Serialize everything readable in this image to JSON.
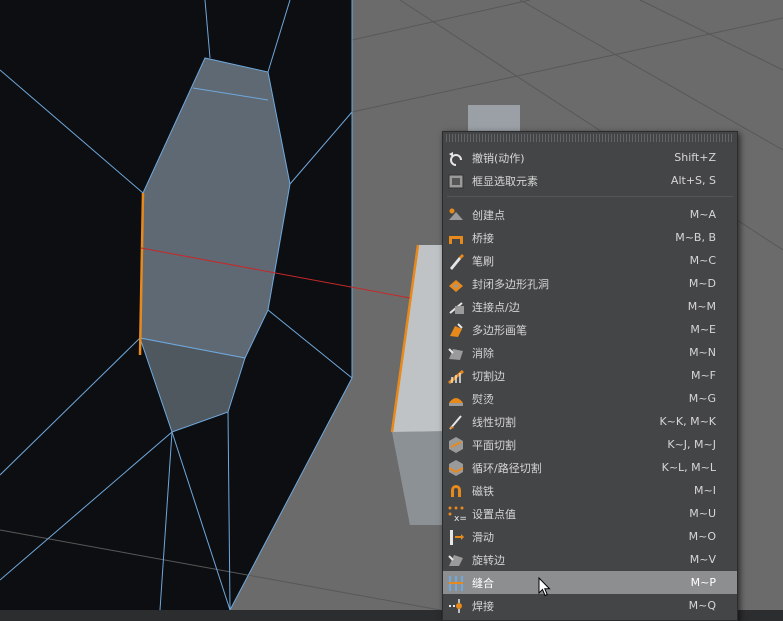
{
  "menu": {
    "group_top": [
      {
        "label": "撤销(动作)",
        "shortcut": "Shift+Z",
        "icon": "undo-icon"
      },
      {
        "label": "框显选取元素",
        "shortcut": "Alt+S, S",
        "icon": "frame-selected-icon"
      }
    ],
    "group_tools": [
      {
        "label": "创建点",
        "shortcut": "M~A",
        "icon": "create-point-icon"
      },
      {
        "label": "桥接",
        "shortcut": "M~B, B",
        "icon": "bridge-icon"
      },
      {
        "label": "笔刷",
        "shortcut": "M~C",
        "icon": "brush-icon"
      },
      {
        "label": "封闭多边形孔洞",
        "shortcut": "M~D",
        "icon": "close-polygon-hole-icon"
      },
      {
        "label": "连接点/边",
        "shortcut": "M~M",
        "icon": "connect-points-edges-icon"
      },
      {
        "label": "多边形画笔",
        "shortcut": "M~E",
        "icon": "polygon-pen-icon"
      },
      {
        "label": "消除",
        "shortcut": "M~N",
        "icon": "dissolve-icon"
      },
      {
        "label": "切割边",
        "shortcut": "M~F",
        "icon": "edge-cut-icon"
      },
      {
        "label": "熨烫",
        "shortcut": "M~G",
        "icon": "iron-icon"
      },
      {
        "label": "线性切割",
        "shortcut": "K~K, M~K",
        "icon": "line-cut-icon"
      },
      {
        "label": "平面切割",
        "shortcut": "K~J, M~J",
        "icon": "plane-cut-icon"
      },
      {
        "label": "循环/路径切割",
        "shortcut": "K~L, M~L",
        "icon": "loop-path-cut-icon"
      },
      {
        "label": "磁铁",
        "shortcut": "M~I",
        "icon": "magnet-icon"
      },
      {
        "label": "设置点值",
        "shortcut": "M~U",
        "icon": "set-point-value-icon"
      },
      {
        "label": "滑动",
        "shortcut": "M~O",
        "icon": "slide-icon"
      },
      {
        "label": "旋转边",
        "shortcut": "M~V",
        "icon": "spin-edge-icon"
      },
      {
        "label": "缝合",
        "shortcut": "M~P",
        "icon": "stitch-and-sew-icon",
        "active": true
      },
      {
        "label": "焊接",
        "shortcut": "M~Q",
        "icon": "weld-icon"
      }
    ]
  },
  "colors": {
    "accent_orange": "#e8891c",
    "edge_blue": "#6fa8dc",
    "menu_bg": "#444547",
    "menu_highlight": "#8d8e90"
  }
}
